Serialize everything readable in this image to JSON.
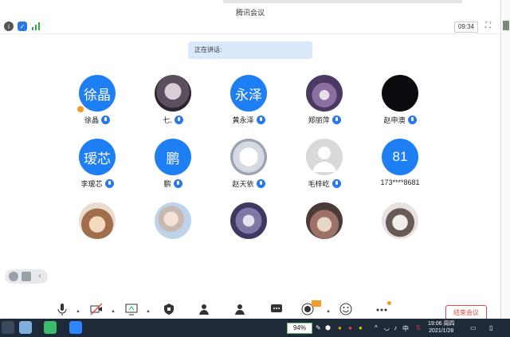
{
  "window": {
    "title": "腾讯会议",
    "timer": "09:34",
    "speaking_label": "正在讲话:"
  },
  "participants": [
    {
      "name": "徐晶",
      "avatar_text": "徐晶",
      "avatar_type": "text",
      "color": "#1e7ef3",
      "host": true
    },
    {
      "name": "七.",
      "avatar_text": "",
      "avatar_type": "photo",
      "color": "#4a4452"
    },
    {
      "name": "黄永泽",
      "avatar_text": "永泽",
      "avatar_type": "text",
      "color": "#1e7ef3"
    },
    {
      "name": "郑丽萍",
      "avatar_text": "",
      "avatar_type": "photo",
      "color": "#5c4a72"
    },
    {
      "name": "赵申澳",
      "avatar_text": "",
      "avatar_type": "photo",
      "color": "#0a0a0f"
    },
    {
      "name": "李瑷芯",
      "avatar_text": "瑷芯",
      "avatar_type": "text",
      "color": "#1e7ef3"
    },
    {
      "name": "鹏",
      "avatar_text": "鹏",
      "avatar_type": "text",
      "color": "#1e7ef3"
    },
    {
      "name": "赵天依",
      "avatar_text": "",
      "avatar_type": "photo",
      "color": "#cfd6e0"
    },
    {
      "name": "毛梓屹",
      "avatar_text": "",
      "avatar_type": "photo",
      "color": "#d9d9d9"
    },
    {
      "name": "173****8681",
      "avatar_text": "81",
      "avatar_type": "text",
      "color": "#1e7ef3"
    },
    {
      "name": "",
      "avatar_text": "",
      "avatar_type": "photo",
      "color": "#c79c7a"
    },
    {
      "name": "",
      "avatar_text": "",
      "avatar_type": "photo",
      "color": "#bcd3ea"
    },
    {
      "name": "",
      "avatar_text": "",
      "avatar_type": "photo",
      "color": "#a7a4c9"
    },
    {
      "name": "",
      "avatar_text": "",
      "avatar_type": "photo",
      "color": "#b48f84"
    },
    {
      "name": "",
      "avatar_text": "",
      "avatar_type": "photo",
      "color": "#6a5a55"
    }
  ],
  "toolbar": {
    "end_meeting_label": "结束会议"
  },
  "taskbar": {
    "battery": "94%",
    "ime": "中",
    "time": "19:06",
    "weekday": "周四",
    "date": "2021/1/28"
  },
  "icons": {
    "info": "info-icon",
    "shield": "shield-icon",
    "signal": "signal-icon",
    "fullscreen": "fullscreen-icon"
  }
}
